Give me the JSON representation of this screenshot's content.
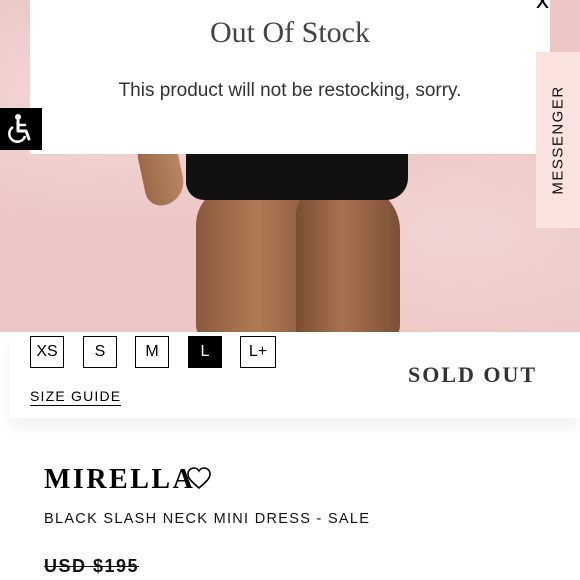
{
  "modal": {
    "title": "Out Of Stock",
    "message": "This product will not be restocking, sorry.",
    "close_label": "x"
  },
  "messenger": {
    "label": "MESSENGER"
  },
  "accessibility": {
    "icon": "wheelchair-accessibility-icon"
  },
  "sizes": {
    "options": [
      "XS",
      "S",
      "M",
      "L",
      "L+"
    ],
    "selected": "L",
    "guide_label": "SIZE GUIDE"
  },
  "status": {
    "sold_out_label": "SOLD OUT"
  },
  "product": {
    "name": "MIRELLA",
    "subtitle": "BLACK SLASH NECK MINI DRESS - SALE",
    "price": "USD $195",
    "wishlist_icon": "heart-icon"
  },
  "colors": {
    "hero_background": "#ecc6c4",
    "messenger_tab": "#fbe3e0",
    "selected_size": "#000000"
  }
}
